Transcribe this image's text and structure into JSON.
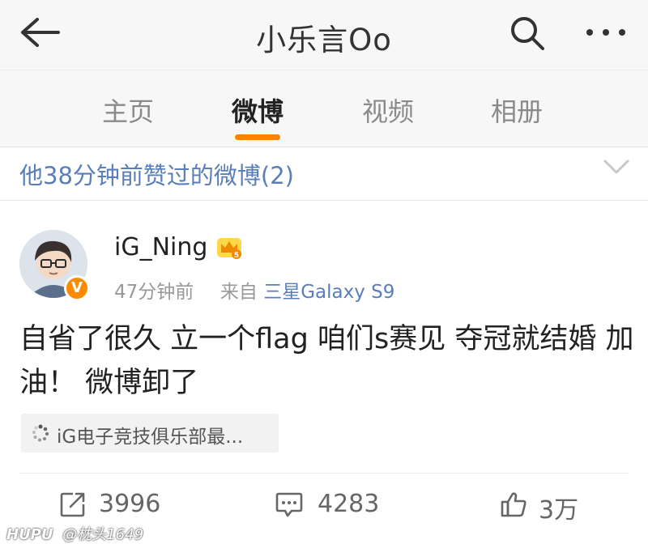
{
  "header": {
    "title": "小乐言Oo",
    "back_icon": "back-arrow-icon",
    "search_icon": "search-icon",
    "more_icon": "more-horizontal-icon"
  },
  "tabs": [
    {
      "label": "主页",
      "active": false
    },
    {
      "label": "微博",
      "active": true
    },
    {
      "label": "视频",
      "active": false
    },
    {
      "label": "相册",
      "active": false
    }
  ],
  "liked_bar": {
    "text": "他38分钟前赞过的微博(2)",
    "expand_icon": "chevron-down-icon"
  },
  "post": {
    "author": "iG_Ning",
    "time": "47分钟前",
    "source_prefix": "来自",
    "source": "三星Galaxy S9",
    "text": "自省了很久 立一个flag 咱们s赛见 夺冠就结婚 加油！ 微博卸了",
    "topic": "iG电子竞技俱乐部最...",
    "verified_badge": "V",
    "stats": {
      "reposts": "3996",
      "comments": "4283",
      "likes": "3万"
    }
  },
  "watermark": {
    "brand": "HUPU",
    "handle": "@枕头1649"
  },
  "colors": {
    "accent_orange": "#ff8200",
    "link_blue": "#5a7eb8",
    "badge_orange": "#ff8a00"
  }
}
